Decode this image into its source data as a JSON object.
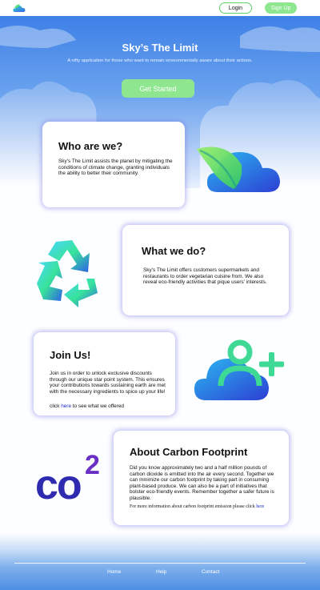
{
  "header": {
    "logo": "cloud-leaf-logo",
    "login_label": "Login",
    "signup_label": "Sign Up"
  },
  "hero": {
    "title": "Sky’s The Limit",
    "subtitle": "A nifty application for those who want to remain enveonmentally aware about their actions.",
    "cta_label": "Get Started"
  },
  "sections": {
    "who": {
      "heading": "Who are we?",
      "body": "Sky’s The Limit assists the planet by mitigating the conditions of climate change, granting individuals the ability to better their community.",
      "icon": "cloud-leaf-icon"
    },
    "what": {
      "heading": "What we do?",
      "body": "Sky’s The Limit offers customers supermarkets and restaurants to order vegetarian cuisine from. We also reveal eco-friendly activities that pique users’ interests.",
      "icon": "recycle-icon"
    },
    "join": {
      "heading": "Join Us!",
      "body": "Join us in order to unlock exclusive discounts through our unique star point system. This ensures your contributions towards sustaining earth are met with the necessary ingredients to spice up your life!",
      "note_prefix": "click ",
      "note_link": "here",
      "note_suffix": " to see what we offered",
      "icon": "cloud-add-user-icon"
    },
    "carbon": {
      "heading": "About Carbon Footprint",
      "body": "Did you know approximately two and a half million pounds of carbon dioxide is emitted into the air every second. Together we can minimize our carbon footprint by taking part in consuming plant-based produce. We can also be a part of initiatives that bolster eco-friendly events. Remember together a safer future is plausible.",
      "note_prefix": "For more information about carbon footprint emission please click ",
      "note_link": "here",
      "icon_text": "co",
      "icon_sup": "2"
    }
  },
  "footer": {
    "links": [
      "Home",
      "Help",
      "Contact"
    ]
  },
  "colors": {
    "accent_green": "#8ee68f",
    "hero_blue": "#3d80e6",
    "link_blue": "#1a2ccf",
    "card_glow": "#7878e6"
  }
}
